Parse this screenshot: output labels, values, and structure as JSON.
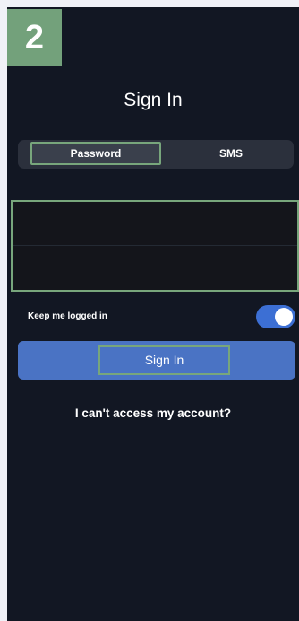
{
  "step_badge": "2",
  "header": {
    "title": "Sign In"
  },
  "tabs": [
    {
      "label": "Password",
      "active": true
    },
    {
      "label": "SMS",
      "active": false
    }
  ],
  "form": {
    "username": {
      "value": "",
      "placeholder": ""
    },
    "password": {
      "value": "",
      "placeholder": ""
    }
  },
  "keep_logged_in": {
    "label": "Keep me logged in",
    "enabled": true
  },
  "sign_in_button": {
    "label": "Sign In"
  },
  "cant_access_link": {
    "label": "I can't access my account?"
  },
  "colors": {
    "background": "#121723",
    "accent": "#4a73c4",
    "toggle_on": "#3c6fd4",
    "highlight_border": "#78a67c",
    "badge": "#73a17b"
  }
}
